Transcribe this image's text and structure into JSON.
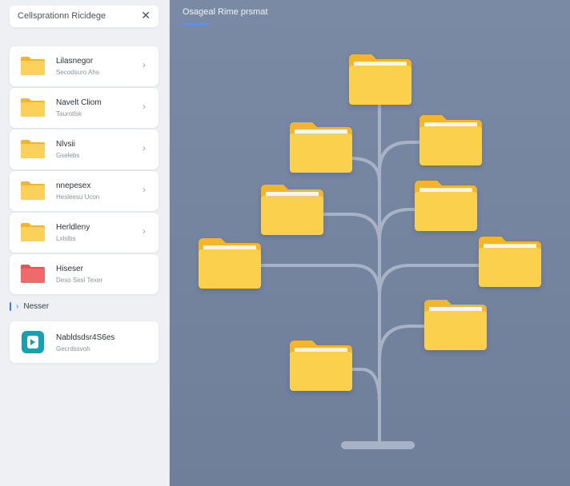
{
  "search": {
    "text": "Cellsprationn Ricidege",
    "close_glyph": "✕"
  },
  "folders": [
    {
      "title": "Lilasnegor",
      "subtitle": "Secodsuro Ahs",
      "color": "#f8c53c"
    },
    {
      "title": "Navelt Cliom",
      "subtitle": "Taurotlsk",
      "color": "#f8c53c"
    },
    {
      "title": "Nlvsii",
      "subtitle": "Gxelebs",
      "color": "#f8c53c"
    },
    {
      "title": "nnepesex",
      "subtitle": "Hesleesu Ucon",
      "color": "#f8c53c"
    },
    {
      "title": "Herldleny",
      "subtitle": "Lxlslbs",
      "color": "#f8c53c"
    },
    {
      "title": "Hiseser",
      "subtitle": "Deso Sesl Texer",
      "color": "#ef6b6b"
    }
  ],
  "section": {
    "label": "Nesser",
    "icon": "collapse-marker-icon"
  },
  "app": {
    "title": "Nabldsdsr4S6es",
    "subtitle": "Gecrdssvoh"
  },
  "main": {
    "title": "Osageal Rime prsmat"
  },
  "colors": {
    "accent": "#3f7be6",
    "folder": "#f8c53c",
    "folder_back": "#f3b52a",
    "folder_red": "#ef6b6b",
    "app_icon": "#16a0b4",
    "canvas": "#7a8aa4",
    "branch": "#a7b2c6"
  }
}
